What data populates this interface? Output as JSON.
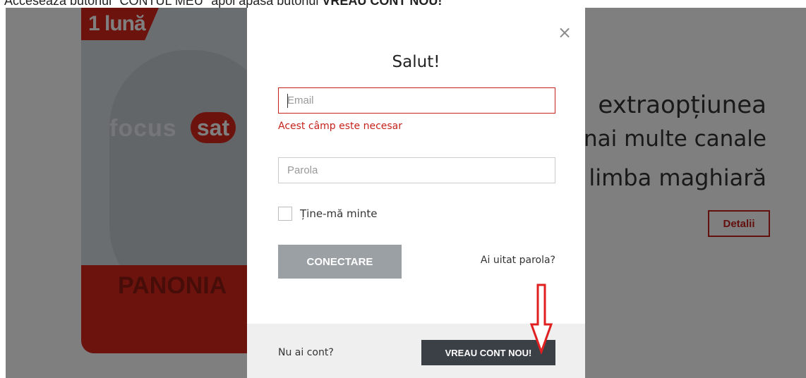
{
  "instruction": {
    "text_start": "Accesează butonul \"CONTUL MEU\" apoi apasă butonul ",
    "text_bold": "VREAU CONT NOU!"
  },
  "background": {
    "card": {
      "month": "1 lună",
      "brand_focus": "focus",
      "brand_sat": "sat",
      "panonia": "PANONIA"
    },
    "hero": {
      "line1": "extraopțiunea",
      "line2": "nai multe canale",
      "line3": "limba maghiară"
    },
    "details_label": "Detalii"
  },
  "modal": {
    "close_icon": "close-icon",
    "title": "Salut!",
    "email": {
      "placeholder": "Email",
      "value": "",
      "error": "Acest câmp este necesar"
    },
    "password": {
      "placeholder": "Parola",
      "value": ""
    },
    "remember": {
      "label": "Ține-mă minte",
      "checked": false
    },
    "connect_label": "CONECTARE",
    "forgot_label": "Ai uitat parola?",
    "footer": {
      "no_account": "Nu ai cont?",
      "new_account_label": "VREAU CONT NOU!"
    }
  },
  "annotation": {
    "icon": "arrow-down-icon",
    "color": "#e02020"
  },
  "colors": {
    "brand_red": "#c4231c",
    "overlay": "rgba(0,0,0,0.5)",
    "connect_button": "#9aa0a4",
    "new_account_button": "#3a4046"
  }
}
